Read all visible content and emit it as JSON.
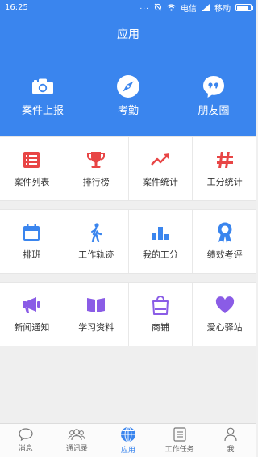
{
  "status_bar": {
    "time": "16:25",
    "dots": "...",
    "carrier_1": "电信",
    "carrier_2": "移动"
  },
  "header": {
    "title": "应用",
    "quick_actions": [
      {
        "label": "案件上报",
        "icon": "camera-icon"
      },
      {
        "label": "考勤",
        "icon": "compass-icon"
      },
      {
        "label": "朋友圈",
        "icon": "chat-quote-icon"
      }
    ]
  },
  "sections": [
    {
      "items": [
        {
          "label": "案件列表",
          "icon": "list-icon",
          "color": "#e84545"
        },
        {
          "label": "排行榜",
          "icon": "trophy-icon",
          "color": "#e84545"
        },
        {
          "label": "案件统计",
          "icon": "trend-up-icon",
          "color": "#e84545"
        },
        {
          "label": "工分统计",
          "icon": "hash-icon",
          "color": "#e84545"
        }
      ]
    },
    {
      "items": [
        {
          "label": "排班",
          "icon": "calendar-icon",
          "color": "#3a85ee"
        },
        {
          "label": "工作轨迹",
          "icon": "walking-person-icon",
          "color": "#3a85ee"
        },
        {
          "label": "我的工分",
          "icon": "bar-chart-icon",
          "color": "#3a85ee"
        },
        {
          "label": "绩效考评",
          "icon": "ribbon-icon",
          "color": "#3a85ee"
        }
      ]
    },
    {
      "items": [
        {
          "label": "新闻通知",
          "icon": "megaphone-icon",
          "color": "#8a5ce6"
        },
        {
          "label": "学习资料",
          "icon": "book-icon",
          "color": "#8a5ce6"
        },
        {
          "label": "商铺",
          "icon": "shopping-bag-icon",
          "color": "#8a5ce6"
        },
        {
          "label": "爱心驿站",
          "icon": "heart-icon",
          "color": "#8a5ce6"
        }
      ]
    }
  ],
  "tabbar": {
    "active_color": "#3a85ee",
    "tabs": [
      {
        "label": "消息",
        "icon": "message-icon"
      },
      {
        "label": "通讯录",
        "icon": "contacts-icon"
      },
      {
        "label": "应用",
        "icon": "globe-icon",
        "active": true
      },
      {
        "label": "工作任务",
        "icon": "task-list-icon"
      },
      {
        "label": "我",
        "icon": "person-icon"
      }
    ]
  }
}
